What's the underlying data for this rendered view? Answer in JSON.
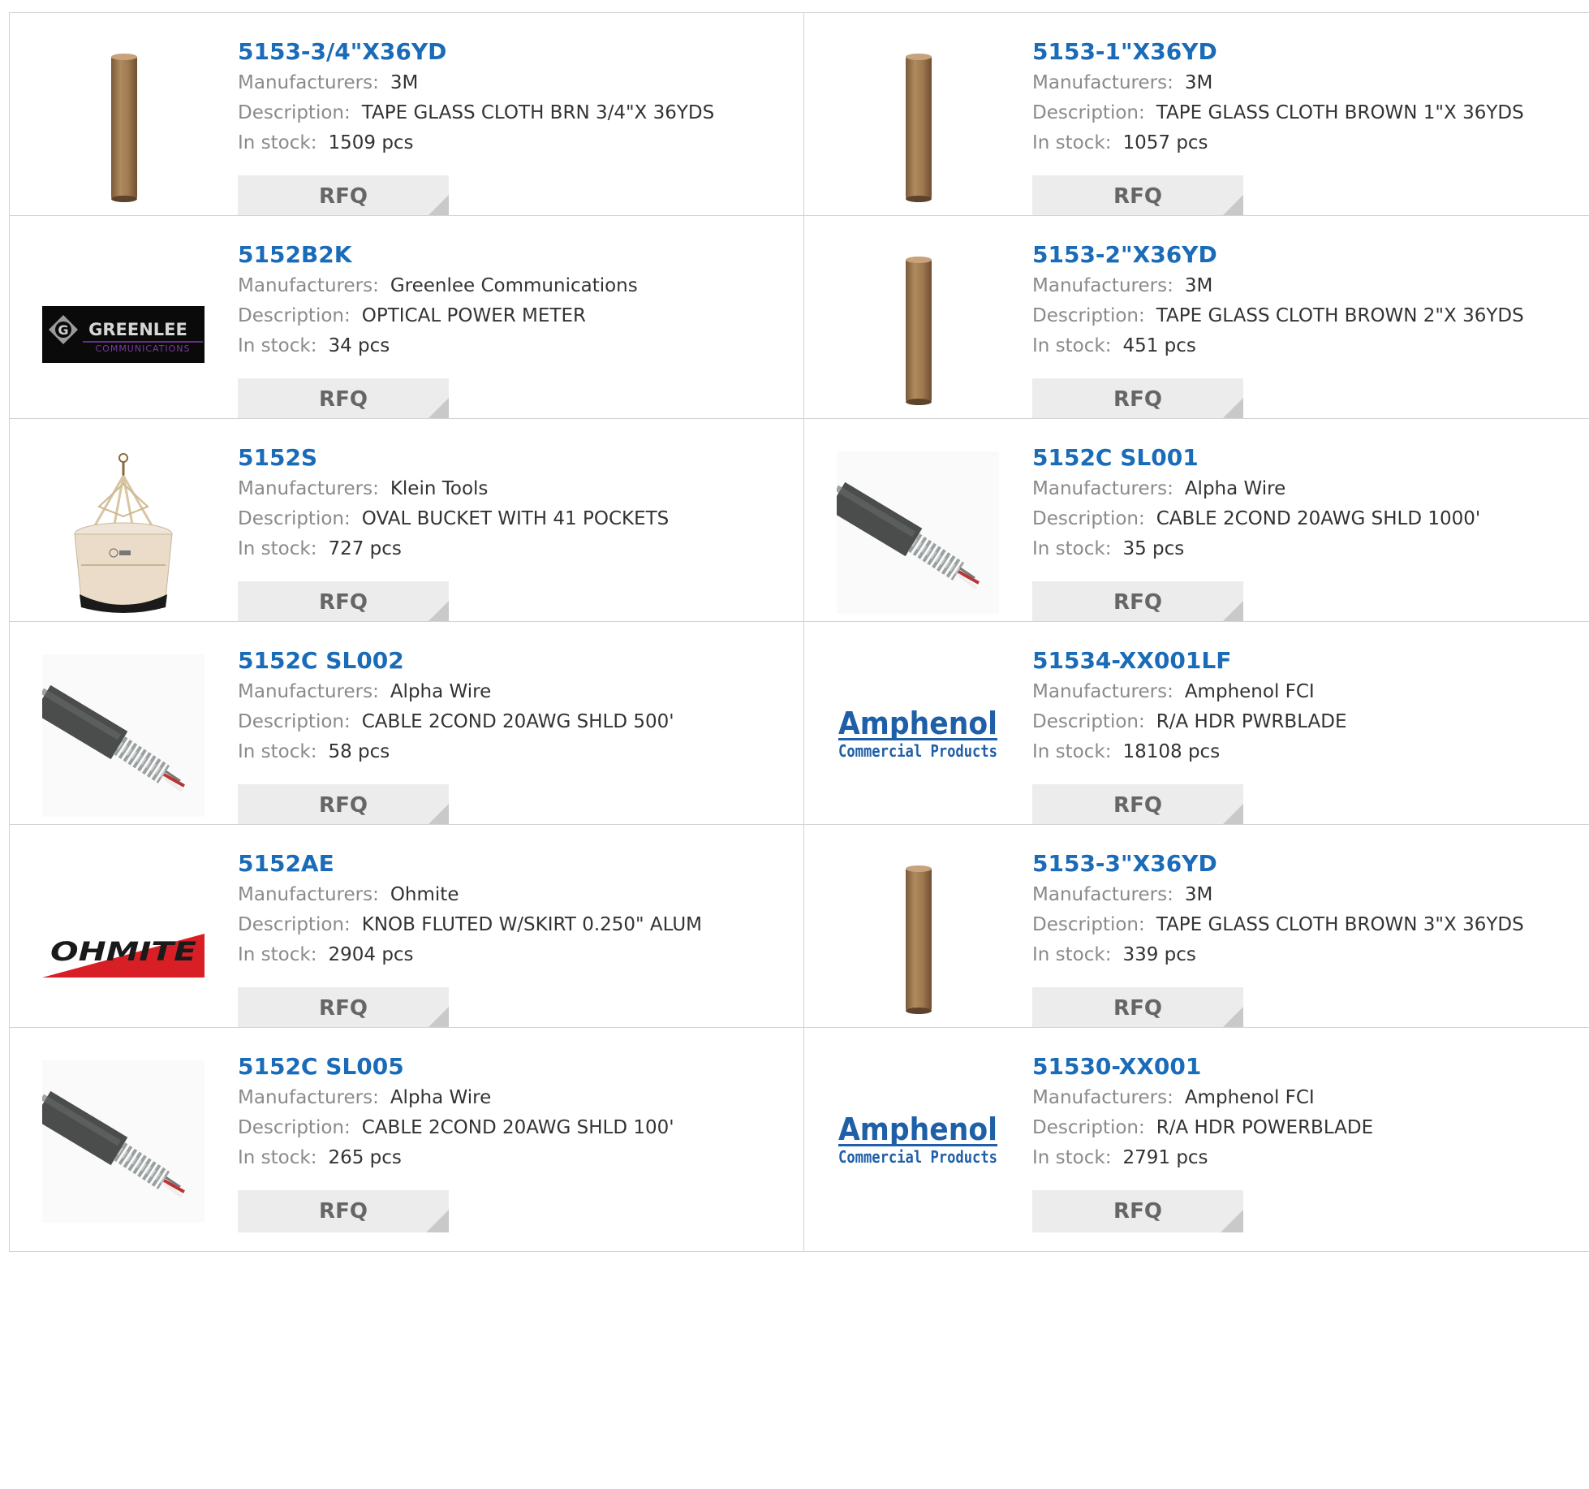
{
  "labels": {
    "manufacturers": "Manufacturers:",
    "description": "Description:",
    "in_stock": "In stock:",
    "rfq": "RFQ"
  },
  "colors": {
    "link": "#1a6bb8",
    "label": "#8a8a8a",
    "value": "#333333",
    "rfq_bg": "#ececec",
    "border": "#d3d3d3"
  },
  "products": [
    {
      "part": "5153-3/4\"X36YD",
      "manufacturer": "3M",
      "description": "TAPE GLASS CLOTH BRN 3/4\"X 36YDS",
      "stock": "1509 pcs",
      "image": "tape-roll"
    },
    {
      "part": "5153-1\"X36YD",
      "manufacturer": "3M",
      "description": "TAPE GLASS CLOTH BROWN 1\"X 36YDS",
      "stock": "1057 pcs",
      "image": "tape-roll"
    },
    {
      "part": "5152B2K",
      "manufacturer": "Greenlee Communications",
      "description": "OPTICAL POWER METER",
      "stock": "34 pcs",
      "image": "greenlee-logo",
      "logo_text": "GREENLEE",
      "logo_sub": "COMMUNICATIONS"
    },
    {
      "part": "5153-2\"X36YD",
      "manufacturer": "3M",
      "description": "TAPE GLASS CLOTH BROWN 2\"X 36YDS",
      "stock": "451 pcs",
      "image": "tape-roll"
    },
    {
      "part": "5152S",
      "manufacturer": "Klein Tools",
      "description": "OVAL BUCKET WITH 41 POCKETS",
      "stock": "727 pcs",
      "image": "bucket"
    },
    {
      "part": "5152C SL001",
      "manufacturer": "Alpha Wire",
      "description": "CABLE 2COND 20AWG SHLD 1000'",
      "stock": "35 pcs",
      "image": "cable"
    },
    {
      "part": "5152C SL002",
      "manufacturer": "Alpha Wire",
      "description": "CABLE 2COND 20AWG SHLD 500'",
      "stock": "58 pcs",
      "image": "cable"
    },
    {
      "part": "51534-XX001LF",
      "manufacturer": "Amphenol FCI",
      "description": "R/A HDR PWRBLADE",
      "stock": "18108 pcs",
      "image": "amphenol-logo",
      "logo_text": "Amphenol",
      "logo_sub": "Commercial Products"
    },
    {
      "part": "5152AE",
      "manufacturer": "Ohmite",
      "description": "KNOB FLUTED W/SKIRT 0.250\" ALUM",
      "stock": "2904 pcs",
      "image": "ohmite-logo",
      "logo_text": "OHMITE"
    },
    {
      "part": "5153-3\"X36YD",
      "manufacturer": "3M",
      "description": "TAPE GLASS CLOTH BROWN 3\"X 36YDS",
      "stock": "339 pcs",
      "image": "tape-roll"
    },
    {
      "part": "5152C SL005",
      "manufacturer": "Alpha Wire",
      "description": "CABLE 2COND 20AWG SHLD 100'",
      "stock": "265 pcs",
      "image": "cable"
    },
    {
      "part": "51530-XX001",
      "manufacturer": "Amphenol FCI",
      "description": "R/A HDR POWERBLADE",
      "stock": "2791 pcs",
      "image": "amphenol-logo",
      "logo_text": "Amphenol",
      "logo_sub": "Commercial Products"
    }
  ]
}
